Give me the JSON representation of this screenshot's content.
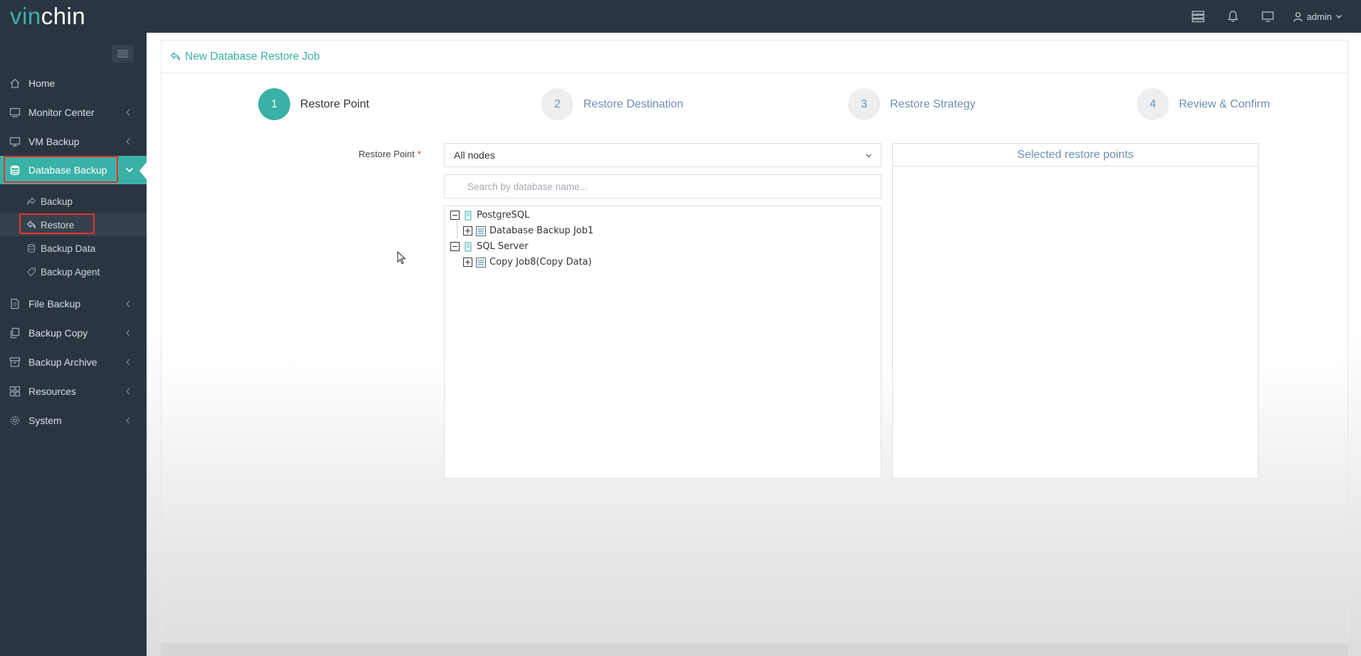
{
  "app": {
    "logo_part1": "vin",
    "logo_part2": "chin"
  },
  "topbar": {
    "user": "admin",
    "icons": [
      "server-icon",
      "bell-icon",
      "monitor-icon",
      "user-icon"
    ]
  },
  "sidebar": {
    "items": [
      {
        "label": "Home",
        "icon": "home-icon"
      },
      {
        "label": "Monitor Center",
        "icon": "monitor-icon"
      },
      {
        "label": "VM Backup",
        "icon": "desktop-icon"
      },
      {
        "label": "Database Backup",
        "icon": "database-icon"
      },
      {
        "label": "File Backup",
        "icon": "file-icon"
      },
      {
        "label": "Backup Copy",
        "icon": "copy-icon"
      },
      {
        "label": "Backup Archive",
        "icon": "archive-icon"
      },
      {
        "label": "Resources",
        "icon": "grid-icon"
      },
      {
        "label": "System",
        "icon": "gear-icon"
      }
    ],
    "sub_items": [
      {
        "label": "Backup",
        "icon": "share-icon"
      },
      {
        "label": "Restore",
        "icon": "reply-icon"
      },
      {
        "label": "Backup Data",
        "icon": "stack-icon"
      },
      {
        "label": "Backup Agent",
        "icon": "tag-icon"
      }
    ]
  },
  "page": {
    "title": "New Database Restore Job"
  },
  "steps": [
    {
      "number": "1",
      "label": "Restore Point",
      "state": "current"
    },
    {
      "number": "2",
      "label": "Restore Destination",
      "state": "pending"
    },
    {
      "number": "3",
      "label": "Restore Strategy",
      "state": "pending"
    },
    {
      "number": "4",
      "label": "Review & Confirm",
      "state": "pending"
    }
  ],
  "form": {
    "restore_point_label": "Restore Point",
    "required_mark": "*",
    "node_select_value": "All nodes",
    "search_placeholder": "Search by database name...",
    "search_value": ""
  },
  "tree": [
    {
      "label": "PostgreSQL",
      "children": [
        {
          "label": "Database Backup Job1"
        }
      ]
    },
    {
      "label": "SQL Server",
      "children": [
        {
          "label": "Copy Job8(Copy Data)"
        }
      ]
    }
  ],
  "selected_panel": {
    "title": "Selected restore points"
  },
  "colors": {
    "accent": "#3ab1a6",
    "sidebar": "#2b3542",
    "step_pending": "#6d8fb3",
    "highlight": "#e8322b"
  }
}
